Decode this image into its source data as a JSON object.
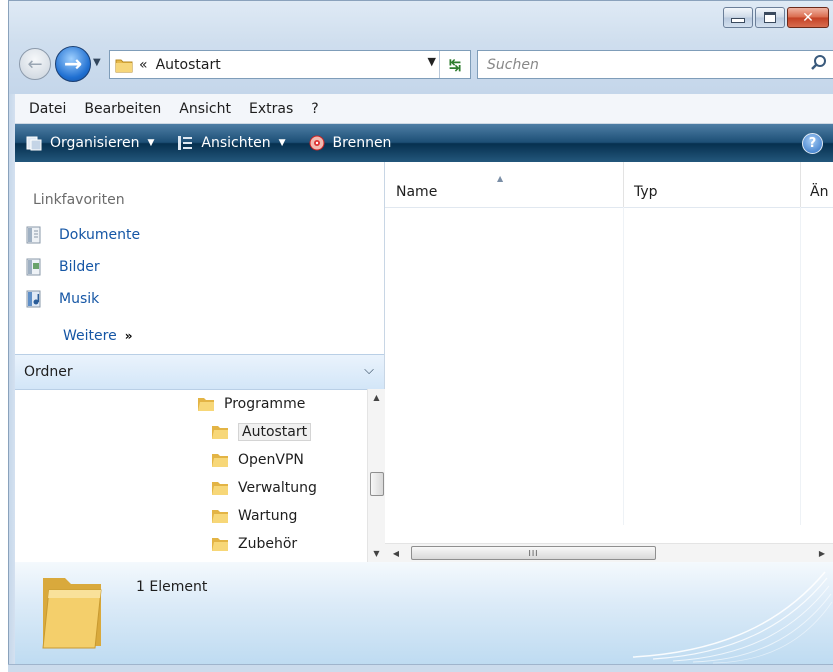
{
  "window": {
    "controls": {
      "minimize_icon": "minimize-icon",
      "maximize_icon": "maximize-icon",
      "close_icon": "close-icon"
    }
  },
  "navigation": {
    "address_chevron": "«",
    "address_path": "Autostart",
    "search_placeholder": "Suchen"
  },
  "menubar": {
    "items": [
      "Datei",
      "Bearbeiten",
      "Ansicht",
      "Extras",
      "?"
    ]
  },
  "commandbar": {
    "organize": "Organisieren",
    "views": "Ansichten",
    "burn": "Brennen"
  },
  "favorites": {
    "title": "Linkfavoriten",
    "items": [
      "Dokumente",
      "Bilder",
      "Musik"
    ],
    "more": "Weitere",
    "more_glyph": "»"
  },
  "folders": {
    "title": "Ordner",
    "tree": [
      {
        "label": "Programme"
      },
      {
        "label": "Autostart",
        "selected": true
      },
      {
        "label": "OpenVPN"
      },
      {
        "label": "Verwaltung"
      },
      {
        "label": "Wartung"
      },
      {
        "label": "Zubehör"
      }
    ]
  },
  "filelist": {
    "columns": [
      "Name",
      "Typ",
      "Än"
    ],
    "hscroll_grip": "III"
  },
  "details": {
    "count": "1 Element"
  },
  "colors": {
    "commandbar": "#1d4f76",
    "link": "#1556a5",
    "ordner_header": "#d3e6f8"
  }
}
